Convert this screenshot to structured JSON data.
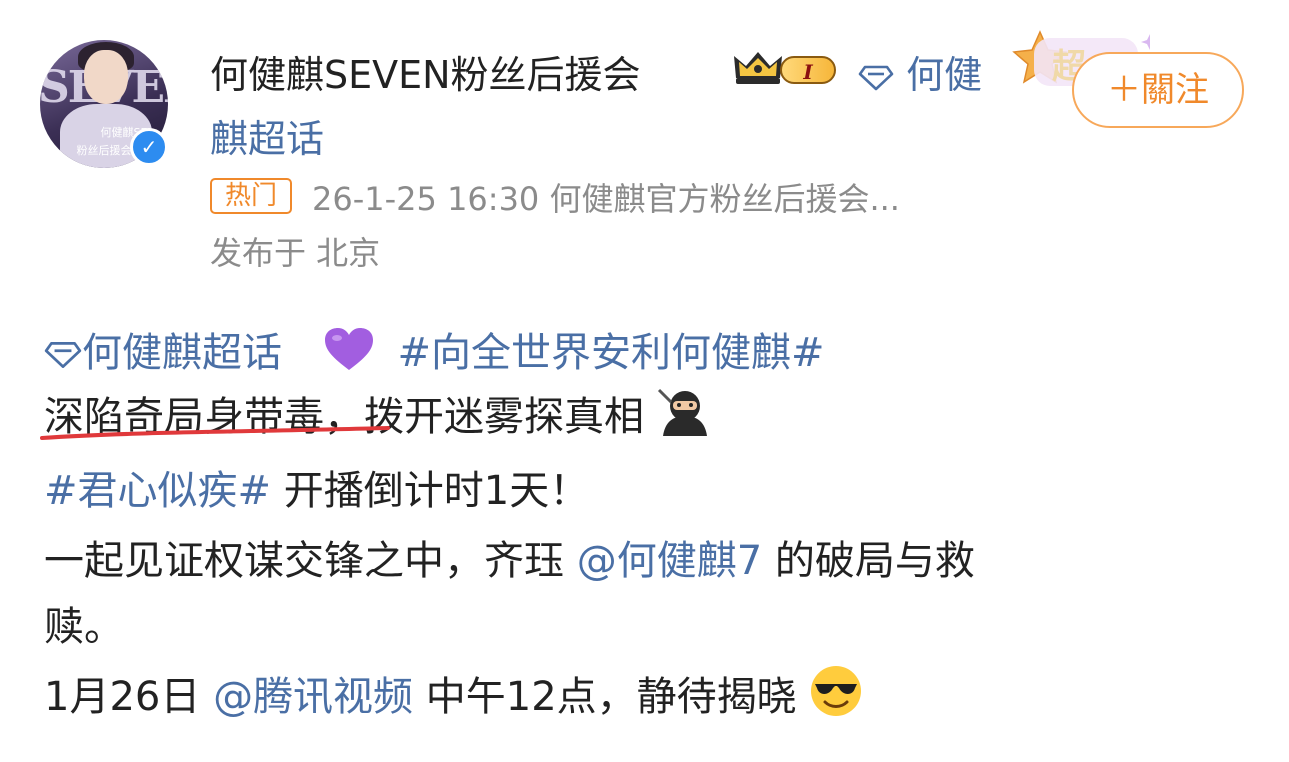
{
  "author": {
    "avatar_text_1": "SEVEN",
    "avatar_caption_1": "何健麒SE",
    "avatar_caption_2": "粉丝后援会",
    "name": "何健麒SEVEN粉丝后援会",
    "rank_label": "I",
    "topic_label": "何健",
    "topic_label_cont": "麒超话",
    "chao_badge": "超"
  },
  "follow_button": {
    "label": "＋關注"
  },
  "meta": {
    "hot": "热门",
    "time_source": "26-1-25 16:30  何健麒官方粉丝后援会...",
    "location": "发布于 北京"
  },
  "post": {
    "line1": {
      "topic": "何健麒超话",
      "hashtag": "#向全世界安利何健麒#"
    },
    "line2": {
      "underlined": "深陷奇局身带毒",
      "rest": "，拨开迷雾探真相"
    },
    "line3": {
      "hashtag": "#君心似疾#",
      "rest": " 开播倒计时1天！"
    },
    "line4": {
      "before": "一起见证权谋交锋之中，齐珏 ",
      "mention": "@何健麒7",
      "after": " 的破局与救"
    },
    "line5": {
      "text": "赎。"
    },
    "line6": {
      "before": "1月26日 ",
      "mention": "@腾讯视频",
      "after": " 中午12点，静待揭晓"
    }
  },
  "colors": {
    "link": "#4a6fa5",
    "follow": "#f0892b",
    "meta": "#8b8b8b",
    "underline": "#e0393b",
    "verified": "#2d8cf0"
  },
  "icons": [
    "verified-icon",
    "crown-icon",
    "diamond-icon",
    "chao-badge-icon",
    "purple-heart-icon",
    "ninja-icon",
    "sunglasses-icon"
  ]
}
